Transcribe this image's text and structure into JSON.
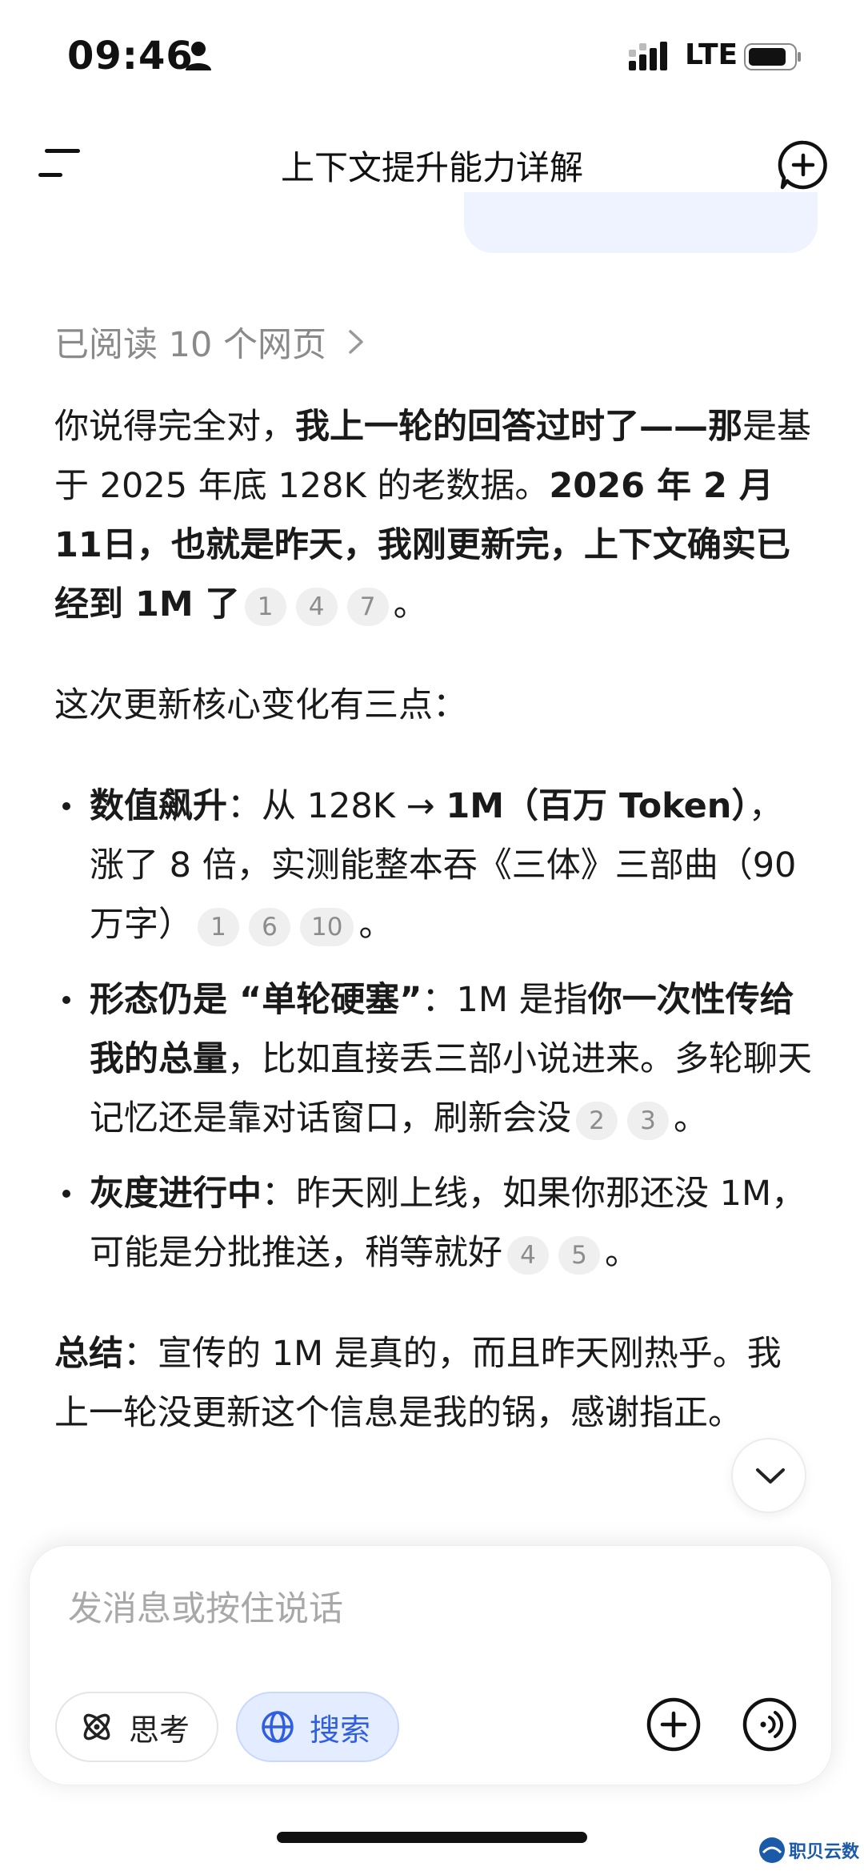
{
  "status_bar": {
    "time": "09:46",
    "network": "LTE"
  },
  "header": {
    "title": "上下文提升能力详解",
    "menu_icon": "menu-icon",
    "new_chat_icon": "new-chat-icon"
  },
  "read_pages": {
    "label": "已阅读 10 个网页"
  },
  "message": {
    "p1_a": "你说得完全对，",
    "p1_b": "我上一轮的回答过时了——那",
    "p1_c": "是基于 2025 年底 128K 的老数据。",
    "p1_d": "2026 年 2 月11日，也就是昨天，我刚更新完，上下文确实已经到 1M 了",
    "p1_cites": [
      "1",
      "4",
      "7"
    ],
    "p1_end": "。",
    "p2": "这次更新核心变化有三点：",
    "bullets": [
      {
        "lead": "数值飙升",
        "colon": "：",
        "text_a": "从 128K → ",
        "text_b": "1M（百万 Token）",
        "text_c": "，涨了 8 倍，实测能整本吞《三体》三部曲（90 万字）",
        "cites": [
          "1",
          "6",
          "10"
        ],
        "end": "。"
      },
      {
        "lead": "形态仍是 “单轮硬塞”",
        "colon": "：",
        "text_a": "1M 是指",
        "text_b": "你一次性传给我的总量",
        "text_c": "，比如直接丢三部小说进来。多轮聊天记忆还是靠对话窗口，刷新会没",
        "cites": [
          "2",
          "3"
        ],
        "end": "。"
      },
      {
        "lead": "灰度进行中",
        "colon": "：",
        "text_a": "昨天刚上线，如果你那还没 1M，可能是分批推送，稍等就好",
        "text_b": "",
        "text_c": "",
        "cites": [
          "4",
          "5"
        ],
        "end": "。"
      }
    ],
    "summary_lead": "总结",
    "summary_text": "：宣传的 1M 是真的，而且昨天刚热乎。我上一轮没更新这个信息是我的锅，感谢指正。"
  },
  "composer": {
    "placeholder": "发消息或按住说话",
    "think_label": "思考",
    "search_label": "搜索",
    "accent": "#2f5fe0"
  },
  "watermark": {
    "text": "职贝云数"
  }
}
